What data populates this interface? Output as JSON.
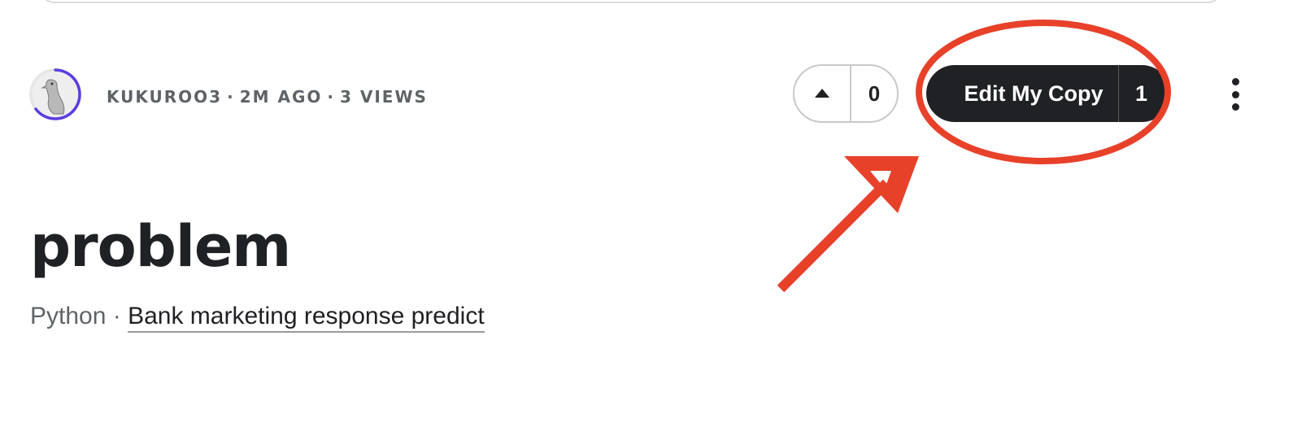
{
  "author": {
    "username": "KUKUROO3",
    "posted": "2M AGO",
    "views": "3 VIEWS",
    "separator": "·"
  },
  "votes": {
    "count": "0"
  },
  "edit_button": {
    "label": "Edit My Copy",
    "count": "1"
  },
  "notebook": {
    "title": "problem",
    "language": "Python",
    "separator": "·",
    "dataset_link": "Bank marketing response predict"
  },
  "colors": {
    "annotation_red": "#e8412a",
    "button_dark": "#202124",
    "avatar_ring": "#5b3de0"
  },
  "icons": {
    "upvote": "caret-up-icon",
    "more": "kebab-menu-icon"
  }
}
